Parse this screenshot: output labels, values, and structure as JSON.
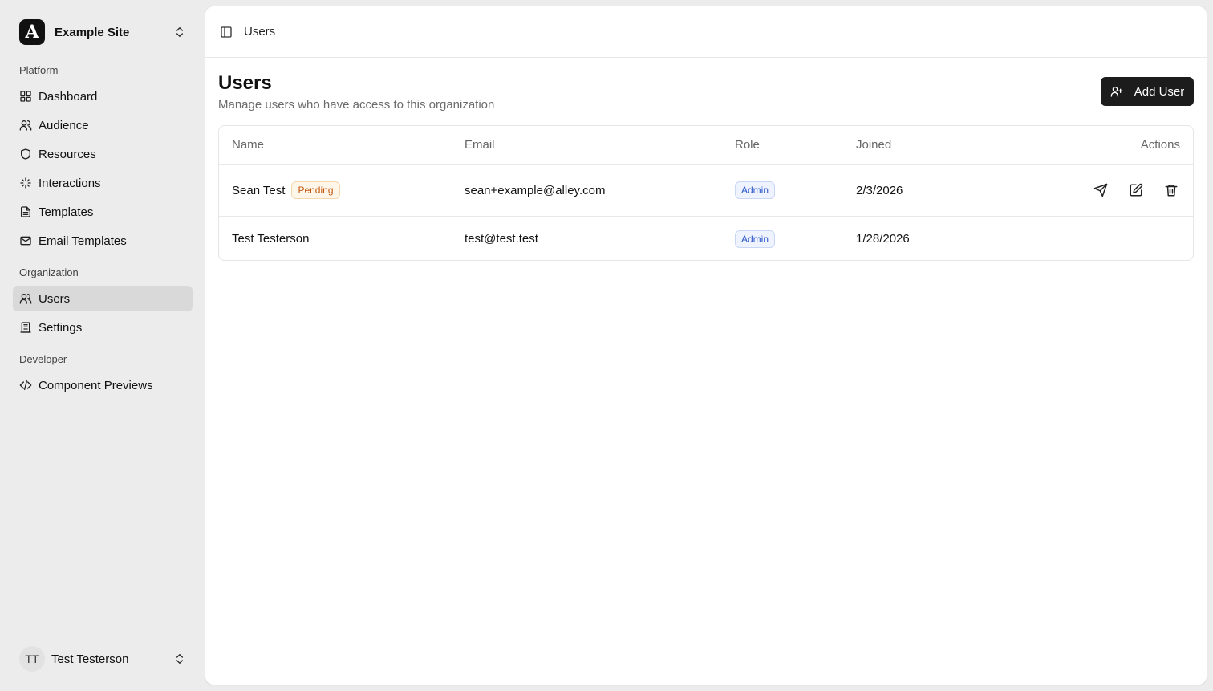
{
  "sidebar": {
    "site": {
      "logo_letter": "A",
      "name": "Example Site"
    },
    "groups": [
      {
        "label": "Platform",
        "items": [
          {
            "label": "Dashboard",
            "icon": "grid-icon"
          },
          {
            "label": "Audience",
            "icon": "users-icon"
          },
          {
            "label": "Resources",
            "icon": "shield-icon"
          },
          {
            "label": "Interactions",
            "icon": "sparkle-icon"
          },
          {
            "label": "Templates",
            "icon": "file-icon"
          },
          {
            "label": "Email Templates",
            "icon": "mail-icon"
          }
        ]
      },
      {
        "label": "Organization",
        "items": [
          {
            "label": "Users",
            "icon": "users-icon",
            "active": true
          },
          {
            "label": "Settings",
            "icon": "building-icon"
          }
        ]
      },
      {
        "label": "Developer",
        "items": [
          {
            "label": "Component Previews",
            "icon": "code-icon"
          }
        ]
      }
    ],
    "user": {
      "initials": "TT",
      "name": "Test Testerson"
    }
  },
  "topbar": {
    "breadcrumb": "Users"
  },
  "page": {
    "title": "Users",
    "subtitle": "Manage users who have access to this organization",
    "add_button_label": "Add User"
  },
  "table": {
    "columns": {
      "name": "Name",
      "email": "Email",
      "role": "Role",
      "joined": "Joined",
      "actions": "Actions"
    },
    "rows": [
      {
        "name": "Sean Test",
        "status": "Pending",
        "email": "sean+example@alley.com",
        "role": "Admin",
        "joined": "2/3/2026"
      },
      {
        "name": "Test Testerson",
        "email": "test@test.test",
        "role": "Admin",
        "joined": "1/28/2026"
      }
    ]
  },
  "colors": {
    "primary_button": "#1c1c1c",
    "pending_badge": "#c2540a",
    "role_badge": "#2b55c9",
    "active_nav": "#d9d9d9"
  }
}
